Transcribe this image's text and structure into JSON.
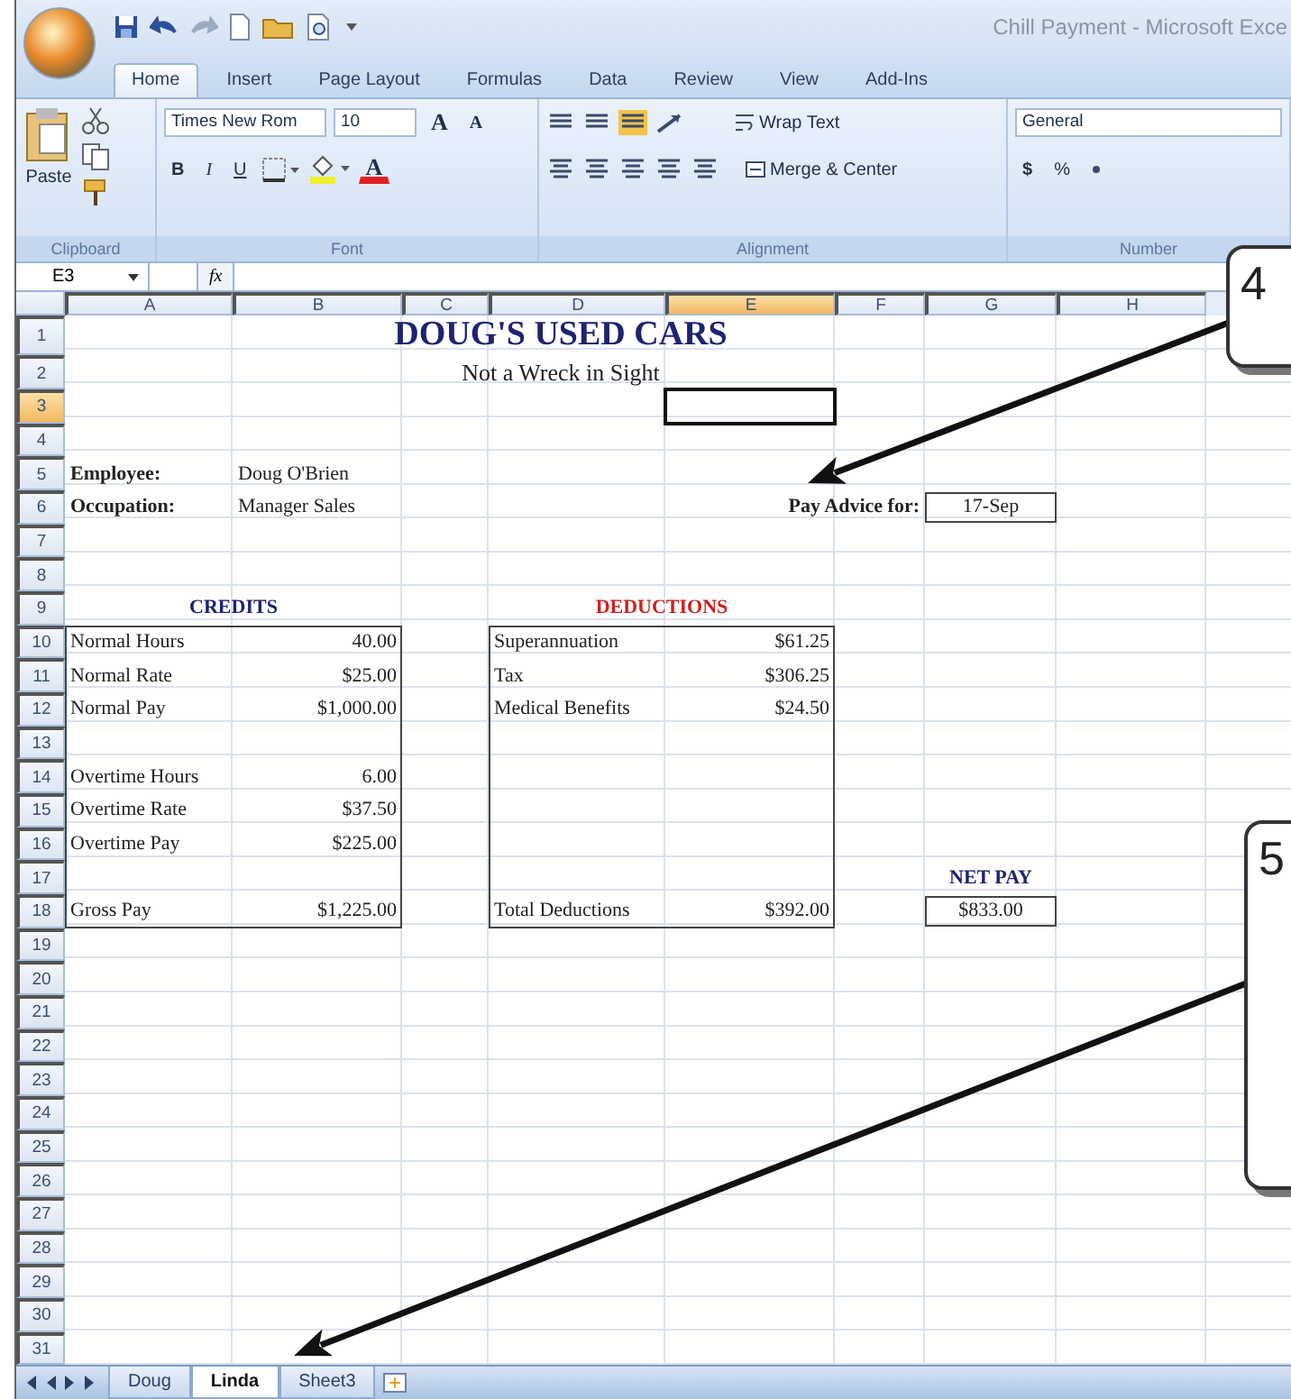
{
  "window": {
    "title": "Chill Payment - Microsoft Exce"
  },
  "ribbon_tabs": [
    {
      "label": "Home",
      "selected": true
    },
    {
      "label": "Insert",
      "selected": false
    },
    {
      "label": "Page Layout",
      "selected": false
    },
    {
      "label": "Formulas",
      "selected": false
    },
    {
      "label": "Data",
      "selected": false
    },
    {
      "label": "Review",
      "selected": false
    },
    {
      "label": "View",
      "selected": false
    },
    {
      "label": "Add-Ins",
      "selected": false
    }
  ],
  "ribbon": {
    "paste": "Paste",
    "font_name": "Times New Rom",
    "font_size": "10",
    "grow_font": "A",
    "shrink_font": "A",
    "bold": "B",
    "italic": "I",
    "underline": "U",
    "font_color": "A",
    "wrap_text": "Wrap Text",
    "merge": "Merge & Center",
    "number_format": "General",
    "currency": "$",
    "percent": "%",
    "groups": [
      "Clipboard",
      "Font",
      "Alignment",
      "Number"
    ]
  },
  "formula_bar": {
    "name_box": "E3",
    "fx": "fx"
  },
  "columns": [
    {
      "label": "A",
      "selected": false
    },
    {
      "label": "B",
      "selected": false
    },
    {
      "label": "C",
      "selected": false
    },
    {
      "label": "D",
      "selected": false
    },
    {
      "label": "E",
      "selected": true
    },
    {
      "label": "F",
      "selected": false
    },
    {
      "label": "G",
      "selected": false
    },
    {
      "label": "H",
      "selected": false
    }
  ],
  "rows": [
    {
      "number": "1",
      "selected": false
    },
    {
      "number": "2",
      "selected": false
    },
    {
      "number": "3",
      "selected": true
    },
    {
      "number": "4",
      "selected": false
    },
    {
      "number": "5",
      "selected": false
    },
    {
      "number": "6",
      "selected": false
    },
    {
      "number": "7",
      "selected": false
    },
    {
      "number": "8",
      "selected": false
    },
    {
      "number": "9",
      "selected": false
    },
    {
      "number": "10",
      "selected": false
    },
    {
      "number": "11",
      "selected": false
    },
    {
      "number": "12",
      "selected": false
    },
    {
      "number": "13",
      "selected": false
    },
    {
      "number": "14",
      "selected": false
    },
    {
      "number": "15",
      "selected": false
    },
    {
      "number": "16",
      "selected": false
    },
    {
      "number": "17",
      "selected": false
    },
    {
      "number": "18",
      "selected": false
    },
    {
      "number": "19",
      "selected": false
    },
    {
      "number": "20",
      "selected": false
    },
    {
      "number": "21",
      "selected": false
    },
    {
      "number": "22",
      "selected": false
    },
    {
      "number": "23",
      "selected": false
    },
    {
      "number": "24",
      "selected": false
    },
    {
      "number": "25",
      "selected": false
    },
    {
      "number": "26",
      "selected": false
    },
    {
      "number": "27",
      "selected": false
    },
    {
      "number": "28",
      "selected": false
    },
    {
      "number": "29",
      "selected": false
    },
    {
      "number": "30",
      "selected": false
    },
    {
      "number": "31",
      "selected": false
    }
  ],
  "sheet": {
    "title": "DOUG'S USED CARS",
    "subtitle": "Not a Wreck in Sight",
    "details": [
      {
        "label": "Employee:",
        "value": "Doug O'Brien"
      },
      {
        "label": "Occupation:",
        "value": "Manager Sales"
      }
    ],
    "pay_advice": {
      "label": "Pay Advice for:",
      "value": "17-Sep"
    },
    "credits": {
      "heading": "CREDITS",
      "groups": [
        [
          {
            "label": "Normal Hours",
            "value": "40.00"
          },
          {
            "label": "Normal Rate",
            "value": "$25.00"
          },
          {
            "label": "Normal Pay",
            "value": "$1,000.00"
          }
        ],
        [
          {
            "label": "Overtime Hours",
            "value": "6.00"
          },
          {
            "label": "Overtime Rate",
            "value": "$37.50"
          },
          {
            "label": "Overtime Pay",
            "value": "$225.00"
          }
        ]
      ],
      "total": {
        "label": "Gross Pay",
        "value": "$1,225.00"
      }
    },
    "deductions": {
      "heading": "DEDUCTIONS",
      "groups": [
        [
          {
            "label": "Superannuation",
            "value": "$61.25"
          },
          {
            "label": "Tax",
            "value": "$306.25"
          },
          {
            "label": "Medical Benefits",
            "value": "$24.50"
          }
        ]
      ],
      "total": {
        "label": "Total Deductions",
        "value": "$392.00"
      }
    },
    "net_pay": {
      "heading": "NET PAY",
      "value": "$833.00"
    }
  },
  "sheet_tabs": [
    {
      "label": "Doug",
      "selected": false
    },
    {
      "label": "Linda",
      "selected": true
    },
    {
      "label": "Sheet3",
      "selected": false
    }
  ],
  "callouts": [
    {
      "number": "4"
    },
    {
      "number": "5"
    }
  ]
}
